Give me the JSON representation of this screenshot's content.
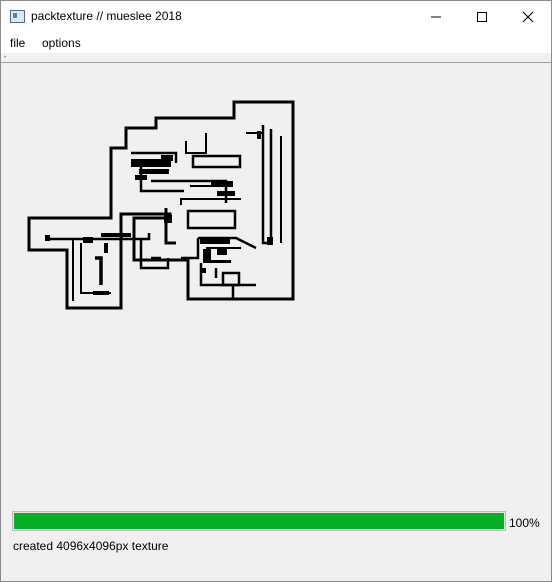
{
  "window": {
    "title": "packtexture // mueslee 2018",
    "icon": "app-icon"
  },
  "menu": {
    "file": "file",
    "options": "options"
  },
  "progress": {
    "percent": 100,
    "label": "100%",
    "color": "#06b025"
  },
  "status": {
    "message": "created 4096x4096px texture"
  }
}
